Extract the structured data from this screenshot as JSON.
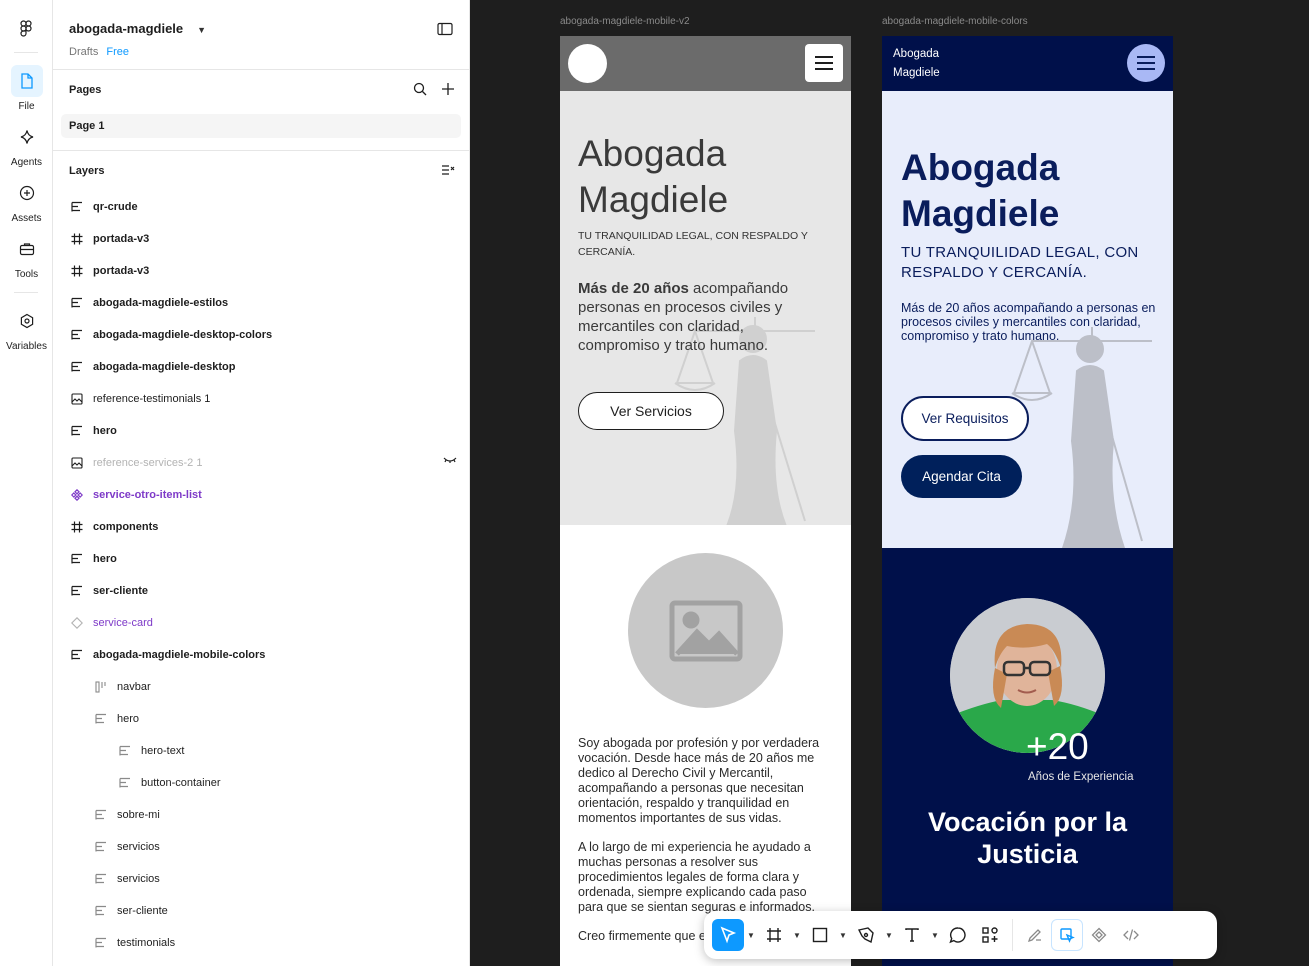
{
  "rail": {
    "items": [
      {
        "label": "File",
        "icon": "file-icon"
      },
      {
        "label": "Agents",
        "icon": "agents-icon"
      },
      {
        "label": "Assets",
        "icon": "assets-icon"
      },
      {
        "label": "Tools",
        "icon": "tools-icon"
      },
      {
        "label": "Variables",
        "icon": "variables-icon"
      }
    ]
  },
  "file": {
    "name": "abogada-magdiele",
    "location": "Drafts",
    "plan": "Free"
  },
  "pages": {
    "title": "Pages",
    "items": [
      "Page 1"
    ]
  },
  "layers": {
    "title": "Layers",
    "items": [
      {
        "name": "qr-crude",
        "icon": "auto-layout-icon"
      },
      {
        "name": "portada-v3",
        "icon": "frame-icon"
      },
      {
        "name": "portada-v3",
        "icon": "frame-icon"
      },
      {
        "name": "abogada-magdiele-estilos",
        "icon": "auto-layout-icon"
      },
      {
        "name": "abogada-magdiele-desktop-colors",
        "icon": "auto-layout-icon"
      },
      {
        "name": "abogada-magdiele-desktop",
        "icon": "auto-layout-icon"
      },
      {
        "name": "reference-testimonials 1",
        "icon": "image-icon"
      },
      {
        "name": "hero",
        "icon": "auto-layout-icon"
      },
      {
        "name": "reference-services-2 1",
        "icon": "image-icon"
      },
      {
        "name": "service-otro-item-list",
        "icon": "component-icon"
      },
      {
        "name": "components",
        "icon": "frame-icon"
      },
      {
        "name": "hero",
        "icon": "auto-layout-icon"
      },
      {
        "name": "ser-cliente",
        "icon": "auto-layout-icon"
      },
      {
        "name": "service-card",
        "icon": "instance-icon"
      },
      {
        "name": "abogada-magdiele-mobile-colors",
        "icon": "auto-layout-icon"
      },
      {
        "name": "navbar",
        "icon": "row-layout-icon"
      },
      {
        "name": "hero",
        "icon": "auto-layout-icon"
      },
      {
        "name": "hero-text",
        "icon": "auto-layout-icon"
      },
      {
        "name": "button-container",
        "icon": "auto-layout-icon"
      },
      {
        "name": "sobre-mi",
        "icon": "auto-layout-icon"
      },
      {
        "name": "servicios",
        "icon": "auto-layout-icon"
      },
      {
        "name": "servicios",
        "icon": "auto-layout-icon"
      },
      {
        "name": "ser-cliente",
        "icon": "auto-layout-icon"
      },
      {
        "name": "testimonials",
        "icon": "auto-layout-icon"
      }
    ]
  },
  "canvas": {
    "frame1": {
      "label": "abogada-magdiele-mobile-v2",
      "title_line1": "Abogada",
      "title_line2": "Magdiele",
      "subtitle": "TU TRANQUILIDAD LEGAL, CON RESPALDO Y CERCANÍA.",
      "desc_bold": "Más de 20 años",
      "desc_rest": " acompañando personas en procesos civiles y mercantiles con claridad, compromiso y trato humano.",
      "button": "Ver Servicios",
      "bio_p1": "Soy abogada por profesión y por verdadera vocación. Desde hace más de 20 años me dedico al Derecho Civil y Mercantil, acompañando a personas que necesitan orientación, respaldo y tranquilidad en momentos importantes de sus vidas.",
      "bio_p2": "A lo largo de mi experiencia he ayudado a muchas personas a resolver sus procedimientos legales de forma clara y ordenada, siempre explicando cada paso para que se sientan seguras e informados.",
      "bio_p3": "Creo firmemente que ejercer el derecho no"
    },
    "frame2": {
      "label": "abogada-magdiele-mobile-colors",
      "brand_line1": "Abogada",
      "brand_line2": "Magdiele",
      "title_line1": "Abogada",
      "title_line2": "Magdiele",
      "subtitle": "TU TRANQUILIDAD LEGAL, CON RESPALDO Y CERCANÍA.",
      "desc": "Más de 20 años acompañando a personas en procesos civiles y mercantiles con claridad, compromiso y trato humano.",
      "button1": "Ver Requisitos",
      "button2": "Agendar Cita",
      "years": "+20",
      "years_label": "Años de Experiencia",
      "heading_line1": "Vocación por la",
      "heading_line2": "Justicia"
    }
  },
  "colors": {
    "accent": "#0d99ff",
    "navy": "#00104a",
    "purple_component": "#7e3ac8"
  }
}
